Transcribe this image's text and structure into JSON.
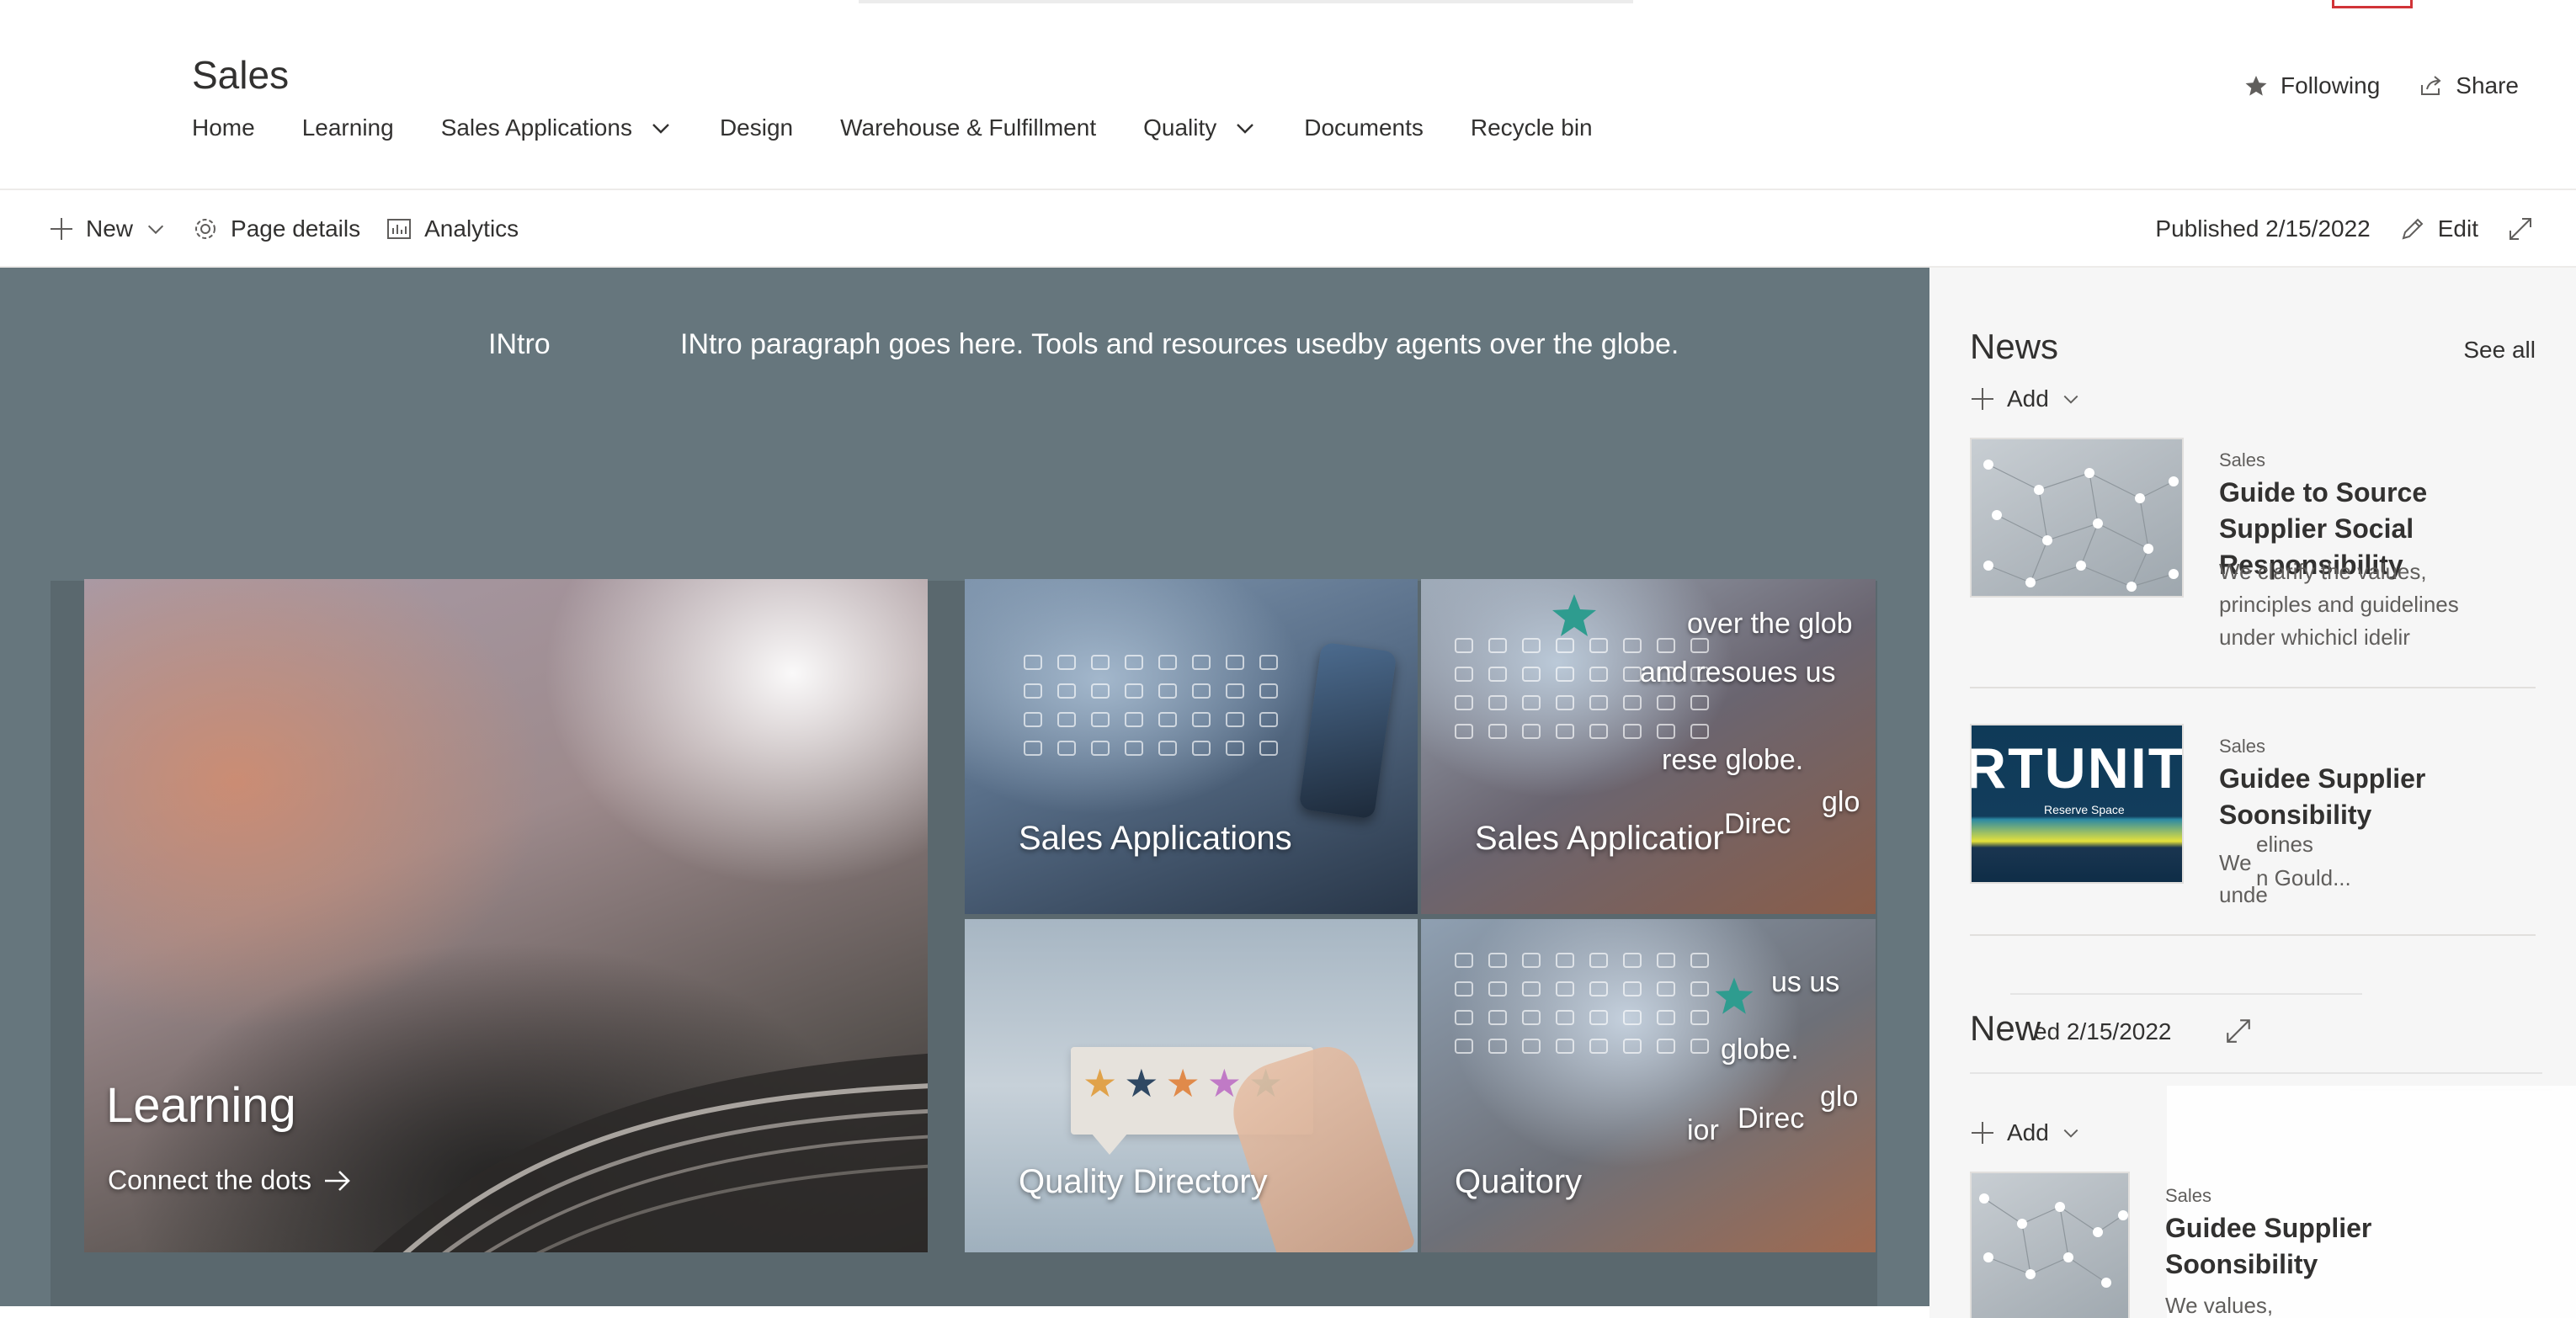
{
  "site": {
    "title": "Sales",
    "nav": [
      {
        "label": "Home",
        "dropdown": false
      },
      {
        "label": "Learning",
        "dropdown": false
      },
      {
        "label": "Sales Applications",
        "dropdown": true
      },
      {
        "label": "Design",
        "dropdown": false
      },
      {
        "label": "Warehouse & Fulfillment",
        "dropdown": false
      },
      {
        "label": "Quality",
        "dropdown": true
      },
      {
        "label": "Documents",
        "dropdown": false
      },
      {
        "label": "Recycle bin",
        "dropdown": false
      }
    ],
    "actions": {
      "following": "Following",
      "share": "Share"
    }
  },
  "command_bar": {
    "new": "New",
    "page_details": "Page details",
    "analytics": "Analytics",
    "published": "Published 2/15/2022",
    "edit": "Edit"
  },
  "hero": {
    "intro_label": "INtro",
    "intro_text": "INtro paragraph goes here. Tools and resources usedby agents over the globe.",
    "tiles": {
      "learning": {
        "title": "Learning",
        "link": "Connect the dots"
      },
      "sales_apps": {
        "title": "Sales Applications"
      },
      "sales_apps_2": {
        "title": "Sales Applicatior",
        "overlay": [
          "over the glob",
          "and resoues us",
          "rese globe.",
          "glo",
          "Direc"
        ]
      },
      "quality": {
        "title": "Quality Directory"
      },
      "quaitory": {
        "title": "Quaitory",
        "overlay": [
          "us us",
          "globe.",
          "glo",
          "Direc",
          "ior"
        ]
      }
    }
  },
  "news": {
    "title": "News",
    "see_all": "See all",
    "add": "Add",
    "items": [
      {
        "source": "Sales",
        "headline": "Guide to Source Supplier Social Responsibility",
        "desc_lines": [
          "We clarify the values,",
          "principles and guidelines",
          "under whichicl idelir"
        ]
      },
      {
        "source": "Sales",
        "headline": "Guidee Supplier Soonsibility",
        "thumb_text": "RTUNITY I",
        "thumb_sub": "Reserve Space",
        "desc_lines": [
          "We",
          "elines",
          "unde",
          "n Gould..."
        ]
      }
    ],
    "second": {
      "title": "New",
      "published": "ed 2/15/2022",
      "add": "Add",
      "item": {
        "source": "Sales",
        "headline": "Guidee Supplier Soonsibility",
        "desc": "We values,"
      }
    }
  },
  "colors": {
    "hero_bg": "#66767d",
    "news_bg": "#f6f6f6",
    "text": "#323130",
    "muted": "#605e5c",
    "accent_red": "#d13438"
  }
}
